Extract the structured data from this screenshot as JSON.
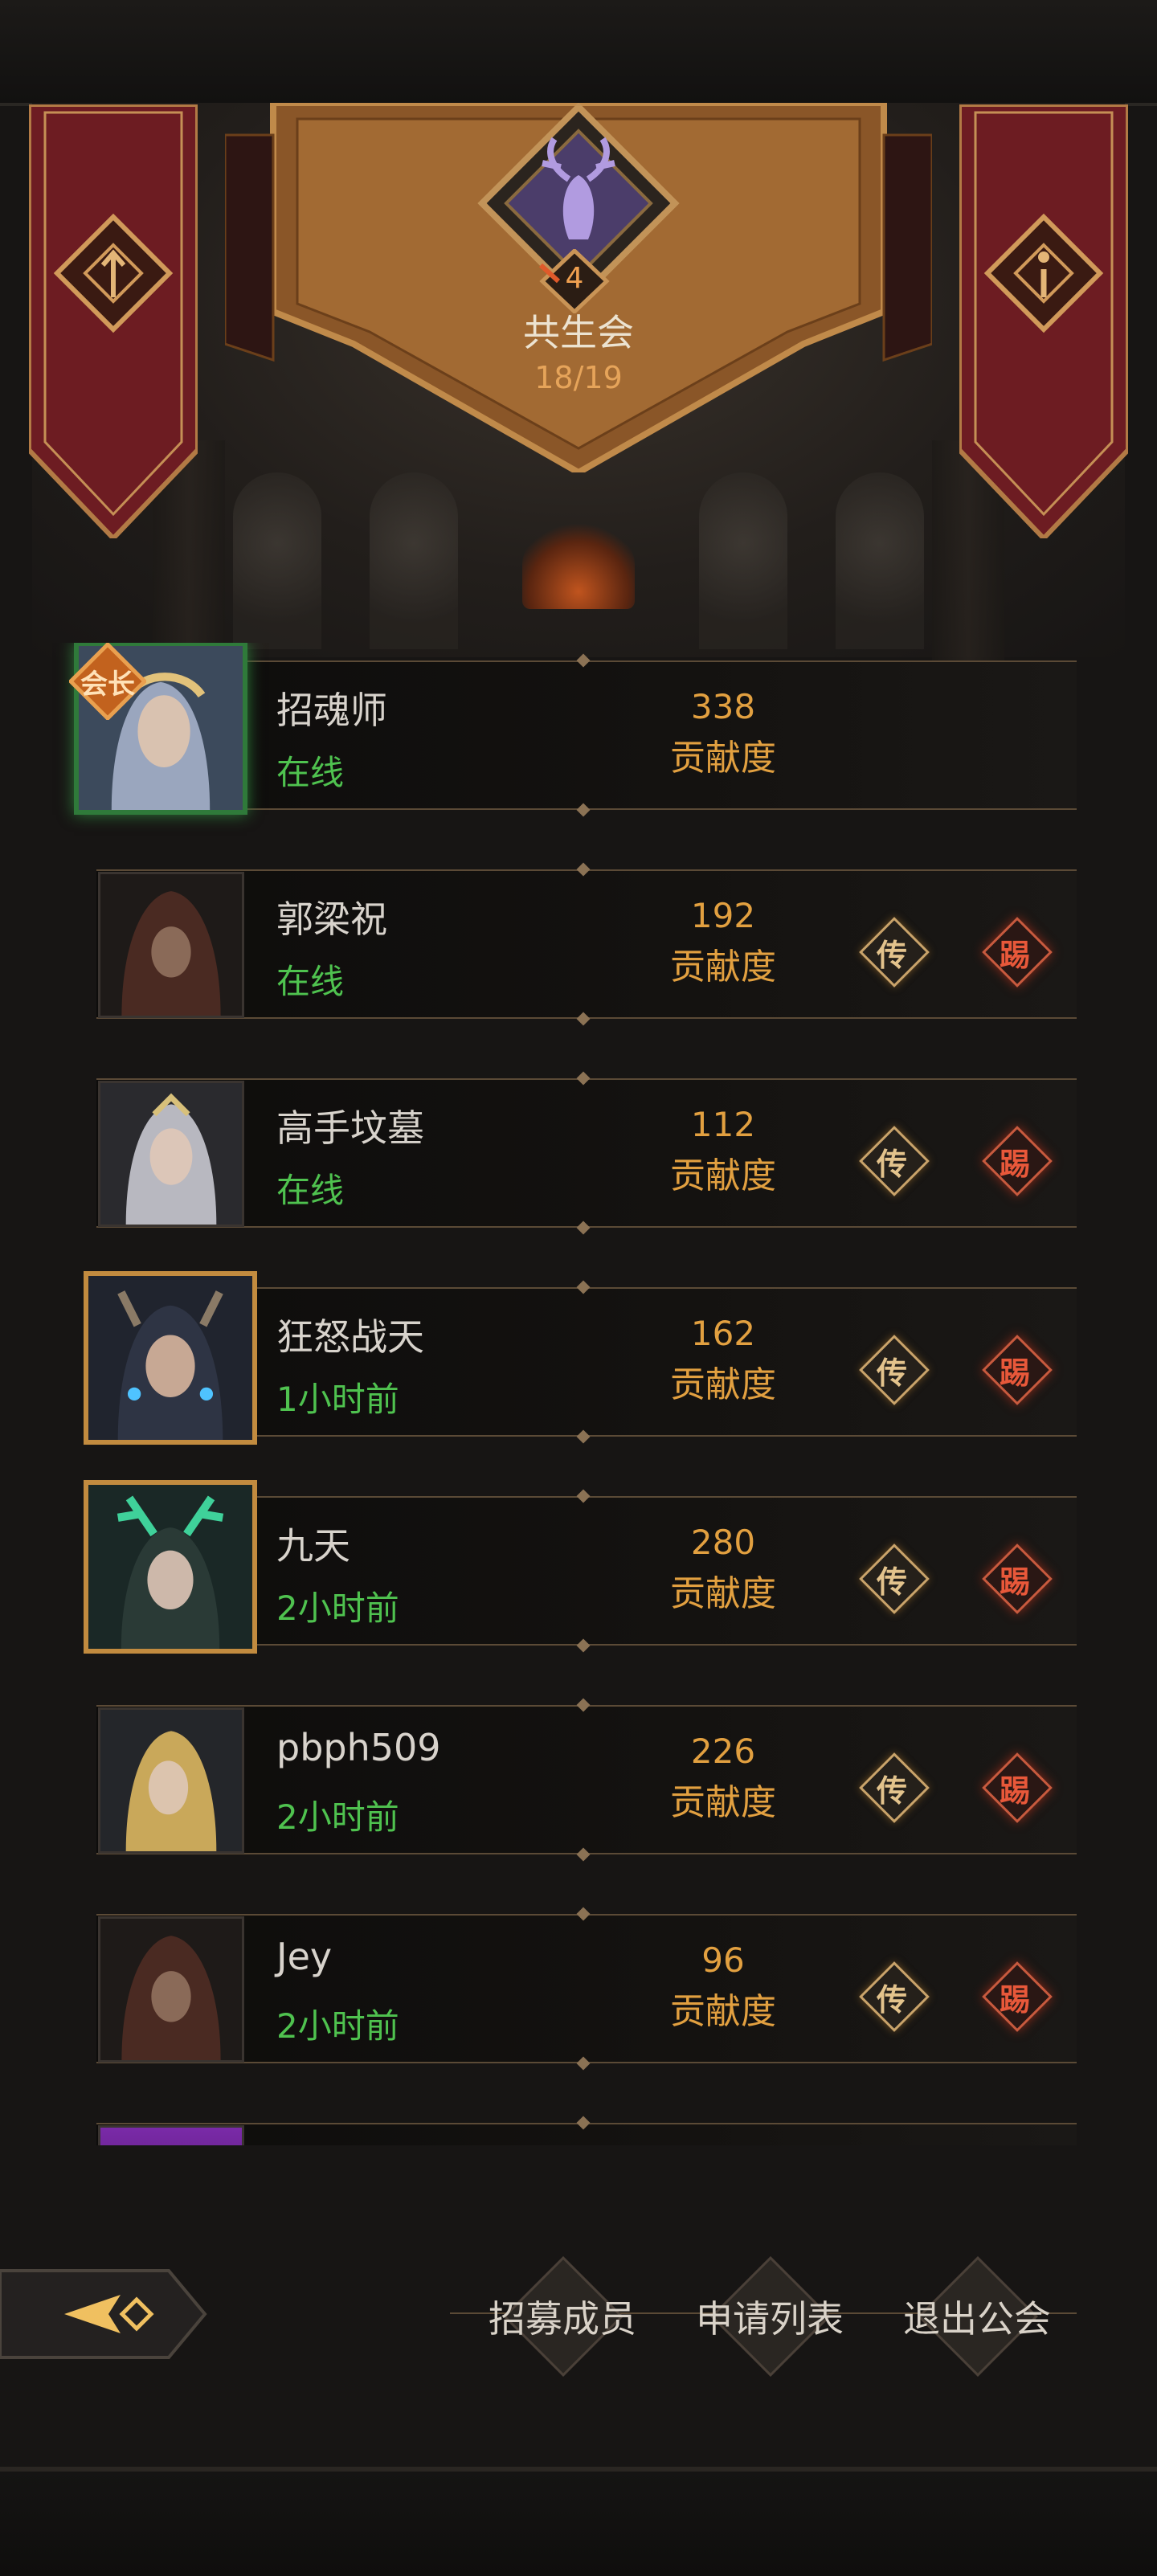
{
  "guild": {
    "level": "4",
    "name": "共生会",
    "members": "18/19"
  },
  "members": [
    {
      "name": "招魂师",
      "status": "在线",
      "score": "338",
      "score_label": "贡献度",
      "leader_badge": "会长",
      "frame": "green",
      "portrait": "elf-female-icon"
    },
    {
      "name": "郭梁祝",
      "status": "在线",
      "score": "192",
      "score_label": "贡献度",
      "frame": "plain",
      "portrait": "hooded-rogue-icon",
      "pass_label": "传",
      "kick_label": "踢"
    },
    {
      "name": "高手坟墓",
      "status": "在线",
      "score": "112",
      "score_label": "贡献度",
      "frame": "plain",
      "portrait": "silver-hair-female-icon",
      "pass_label": "传",
      "kick_label": "踢"
    },
    {
      "name": "狂怒战天",
      "status": "1小时前",
      "score": "162",
      "score_label": "贡献度",
      "frame": "gold",
      "portrait": "horned-warrior-icon",
      "pass_label": "传",
      "kick_label": "踢"
    },
    {
      "name": "九天",
      "status": "2小时前",
      "score": "280",
      "score_label": "贡献度",
      "frame": "gold",
      "portrait": "antler-elf-icon",
      "pass_label": "传",
      "kick_label": "踢"
    },
    {
      "name": "pbph509",
      "status": "2小时前",
      "score": "226",
      "score_label": "贡献度",
      "frame": "plain",
      "portrait": "blonde-paladin-icon",
      "pass_label": "传",
      "kick_label": "踢"
    },
    {
      "name": "Jey",
      "status": "2小时前",
      "score": "96",
      "score_label": "贡献度",
      "frame": "plain",
      "portrait": "hooded-rogue-icon",
      "pass_label": "传",
      "kick_label": "踢"
    }
  ],
  "actions": {
    "recruit": "招募成员",
    "applications": "申请列表",
    "leave": "退出公会"
  },
  "colors": {
    "online": "#4fc24f",
    "score": "#e2a040",
    "gold_frame": "#c28b3f",
    "kick": "#e8583a"
  }
}
